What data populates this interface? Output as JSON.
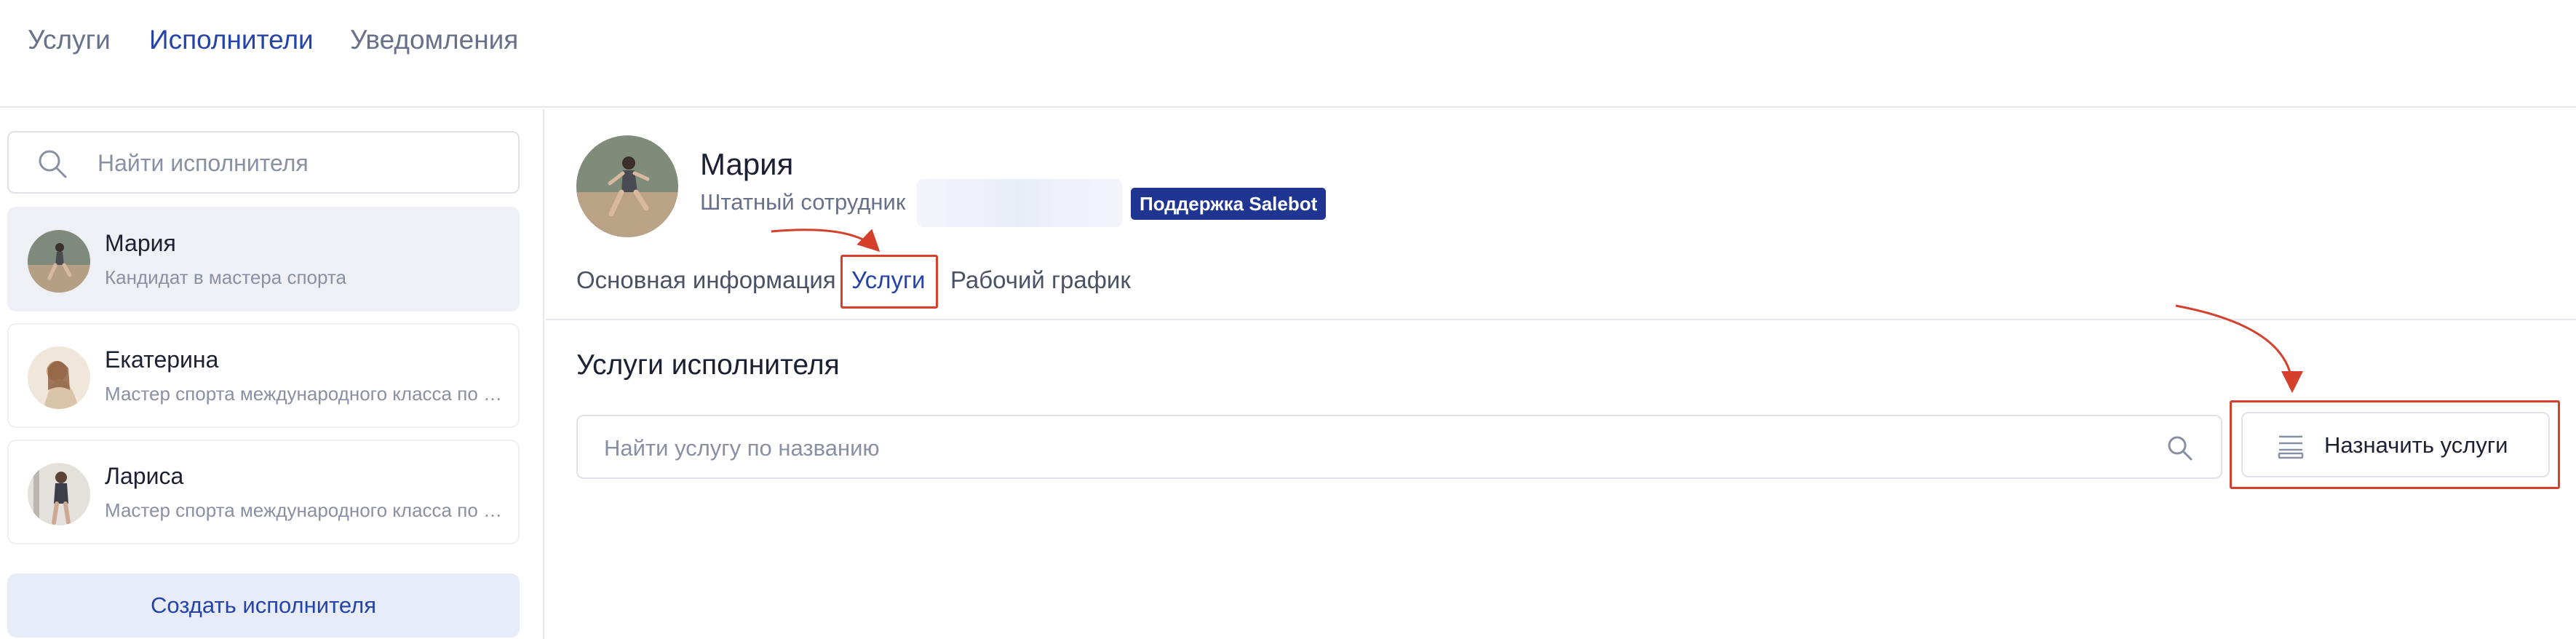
{
  "top_nav": {
    "tabs": [
      {
        "label": "Услуги",
        "active": false
      },
      {
        "label": "Исполнители",
        "active": true
      },
      {
        "label": "Уведомления",
        "active": false
      }
    ]
  },
  "sidebar": {
    "search": {
      "placeholder": "Найти исполнителя",
      "icon": "search-icon"
    },
    "employees": [
      {
        "name": "Мария",
        "title": "Кандидат в мастера спорта",
        "selected": true
      },
      {
        "name": "Екатерина",
        "title": "Мастер спорта международного класса по художественной гимнастике",
        "selected": false
      },
      {
        "name": "Лариса",
        "title": "Мастер спорта международного класса по фитнесу",
        "selected": false
      }
    ],
    "create_button": "Создать исполнителя"
  },
  "profile": {
    "name": "Мария",
    "subtitle": "Штатный сотрудник",
    "badge": "Поддержка Salebot",
    "tabs": [
      {
        "label": "Основная информация",
        "active": false
      },
      {
        "label": "Услуги",
        "active": true
      },
      {
        "label": "Рабочий график",
        "active": false
      }
    ]
  },
  "services": {
    "section_title": "Услуги исполнителя",
    "search_placeholder": "Найти услугу по названию",
    "assign_button": "Назначить услуги",
    "assign_icon": "list-icon"
  },
  "colors": {
    "accent": "#2544a8",
    "badge_bg": "#1f3591",
    "highlight": "#d5402c",
    "muted_text": "#8a90a3"
  }
}
